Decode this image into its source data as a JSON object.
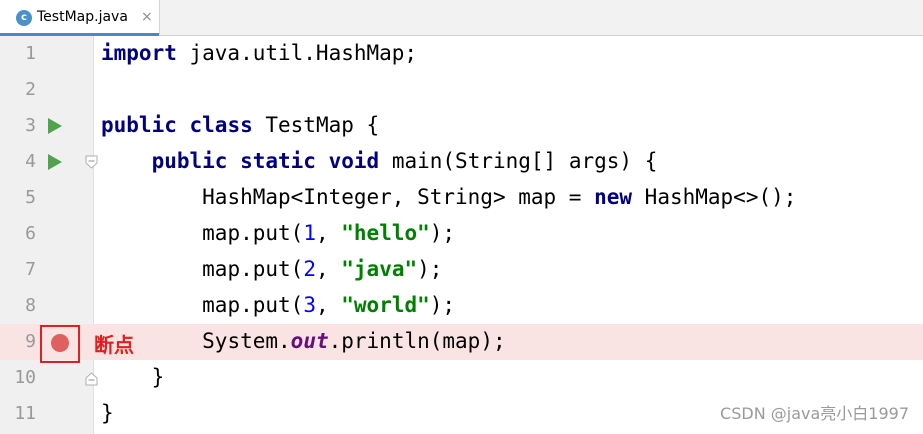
{
  "tab": {
    "title": "TestMap.java",
    "close": "×",
    "icon_letter": "c",
    "icon": "java-class-icon"
  },
  "breakpoint_label": "断点",
  "watermark": "CSDN @java亮小白1997",
  "lines": [
    {
      "num": "1"
    },
    {
      "num": "2"
    },
    {
      "num": "3"
    },
    {
      "num": "4"
    },
    {
      "num": "5"
    },
    {
      "num": "6"
    },
    {
      "num": "7"
    },
    {
      "num": "8"
    },
    {
      "num": "9"
    },
    {
      "num": "10"
    },
    {
      "num": "11"
    }
  ],
  "code": {
    "l1": {
      "kw": "import",
      "rest": " java.util.HashMap;"
    },
    "l3": {
      "kw1": "public",
      "kw2": "class",
      "rest": " TestMap {"
    },
    "l4": {
      "indent": "    ",
      "kw1": "public",
      "kw2": "static",
      "kw3": "void",
      "rest": " main(String[] args) {"
    },
    "l5": {
      "indent": "        ",
      "pre": "HashMap<Integer, String> map = ",
      "kw": "new",
      "post": " HashMap<>();"
    },
    "l6": {
      "indent": "        ",
      "pre": "map.put(",
      "num": "1",
      "mid": ", ",
      "str": "\"hello\"",
      "post": ");"
    },
    "l7": {
      "indent": "        ",
      "pre": "map.put(",
      "num": "2",
      "mid": ", ",
      "str": "\"java\"",
      "post": ");"
    },
    "l8": {
      "indent": "        ",
      "pre": "map.put(",
      "num": "3",
      "mid": ", ",
      "str": "\"world\"",
      "post": ");"
    },
    "l9": {
      "indent": "        ",
      "pre": "System.",
      "field": "out",
      "post": ".println(map);"
    },
    "l10": {
      "text": "    }"
    },
    "l11": {
      "text": "}"
    }
  },
  "colors": {
    "keyword": "#000080",
    "string": "#008000",
    "number": "#0000ff",
    "field": "#660e7a",
    "breakpoint": "#e06060",
    "breakpoint_line_bg": "#fae3e3",
    "annotation": "#e02020",
    "run_arrow": "#4fa34f"
  },
  "gutter_icons": {
    "run": "run-arrow-icon",
    "fold": "fold-icon",
    "breakpoint": "breakpoint-icon"
  }
}
